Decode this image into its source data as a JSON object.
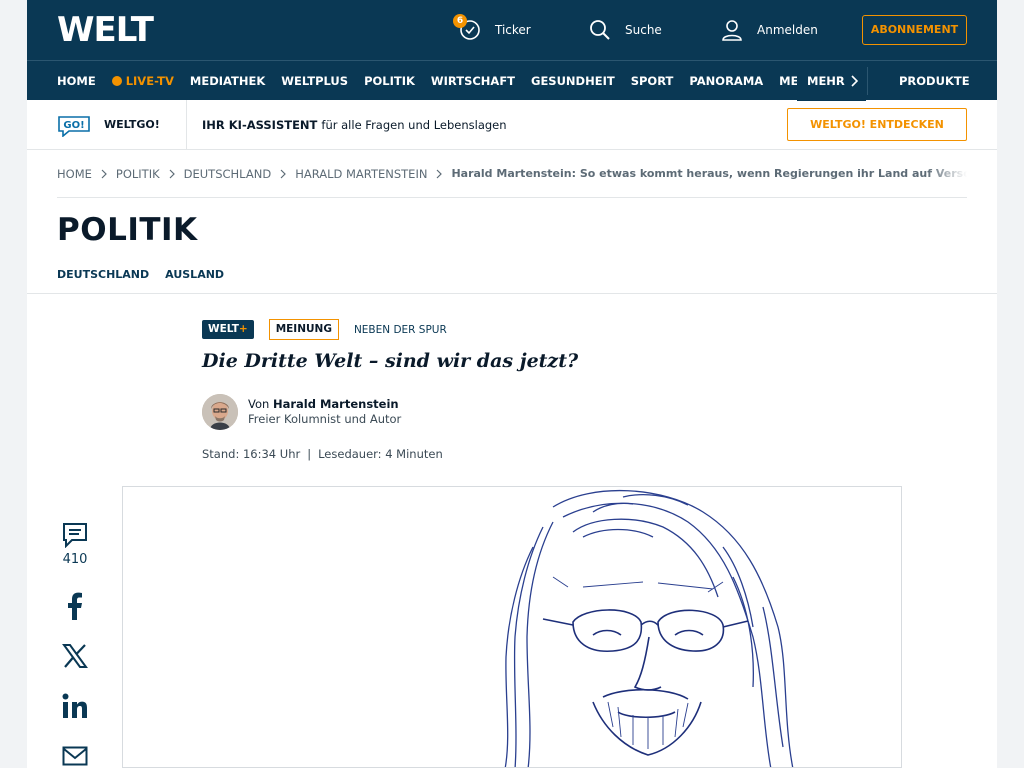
{
  "header": {
    "logo": "WELT",
    "ticker_label": "Ticker",
    "ticker_badge": "6",
    "search_label": "Suche",
    "login_label": "Anmelden",
    "subscribe_label": "ABONNEMENT"
  },
  "nav": {
    "items": [
      "HOME",
      "LIVE-TV",
      "MEDIATHEK",
      "WELTPLUS",
      "POLITIK",
      "WIRTSCHAFT",
      "GESUNDHEIT",
      "SPORT",
      "PANORAMA",
      "MEIN"
    ],
    "more_label": "MEHR",
    "products_label": "PRODUKTE"
  },
  "weltgo": {
    "logo": "GO!",
    "name": "WELTGO!",
    "assistant_bold": "IHR KI-ASSISTENT",
    "assistant_text": "für alle Fragen und Lebenslagen",
    "cta": "WELTGO! ENTDECKEN"
  },
  "breadcrumb": {
    "items": [
      "HOME",
      "POLITIK",
      "DEUTSCHLAND",
      "HARALD MARTENSTEIN"
    ],
    "current": "Harald Martenstein: So etwas kommt heraus, wenn Regierungen ihr Land auf Verschleiß"
  },
  "section": {
    "title": "POLITIK",
    "subnav": [
      "DEUTSCHLAND",
      "AUSLAND"
    ]
  },
  "article": {
    "weltplus_tag": "WELT",
    "weltplus_plus": "+",
    "opinion_tag": "MEINUNG",
    "kicker": "NEBEN DER SPUR",
    "headline": "Die Dritte Welt – sind wir das jetzt?",
    "author_prefix": "Von",
    "author_name": "Harald Martenstein",
    "author_role": "Freier Kolumnist und Autor",
    "timestamp": "Stand: 16:34 Uhr",
    "separator": "|",
    "reading_time": "Lesedauer: 4 Minuten"
  },
  "share": {
    "comment_count": "410",
    "icons": [
      "comment-icon",
      "facebook-icon",
      "x-icon",
      "linkedin-icon",
      "mail-icon"
    ]
  },
  "colors": {
    "brand_navy": "#0a3854",
    "accent_orange": "#f39200",
    "page_bg": "#f1f3f5"
  }
}
